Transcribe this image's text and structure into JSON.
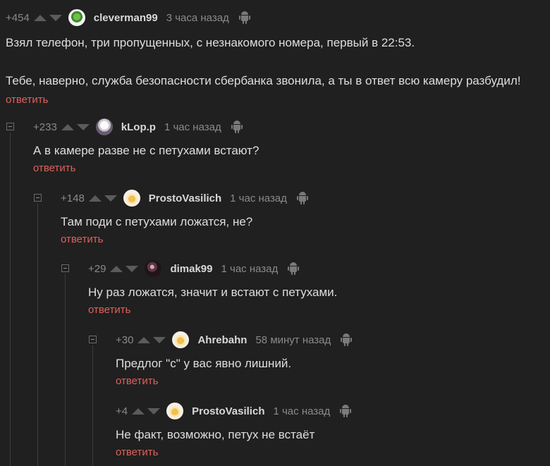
{
  "comments": [
    {
      "rating": "+454",
      "username": "cleverman99",
      "time": "3 часа назад",
      "avatar": "clover-avatar",
      "paragraphs": [
        "Взял телефон, три пропущенных, с незнакомого номера, первый в 22:53.",
        "Тебе, наверно, служба безопасности сбербанка звонила, а ты в ответ всю камеру разбудил!"
      ],
      "reply_label": "ответить"
    },
    {
      "rating": "+233",
      "username": "kLop.p",
      "time": "1 час назад",
      "avatar": "ghost-avatar",
      "text": "А в камере разве не с петухами встают?",
      "reply_label": "ответить"
    },
    {
      "rating": "+148",
      "username": "ProstoVasilich",
      "time": "1 час назад",
      "avatar": "beer-avatar",
      "text": "Там поди с петухами ложатся, не?",
      "reply_label": "ответить"
    },
    {
      "rating": "+29",
      "username": "dimak99",
      "time": "1 час назад",
      "avatar": "dark-avatar",
      "text": "Ну раз ложатся, значит и встают с петухами.",
      "reply_label": "ответить"
    },
    {
      "rating": "+30",
      "username": "Ahrebahn",
      "time": "58 минут назад",
      "avatar": "beer-avatar",
      "text": "Предлог \"с\" у вас явно лишний.",
      "reply_label": "ответить"
    },
    {
      "rating": "+4",
      "username": "ProstoVasilich",
      "time": "1 час назад",
      "avatar": "beer-avatar",
      "text": "Не факт, возможно, петух не встаёт",
      "reply_label": "ответить"
    }
  ],
  "icons": {
    "vote_up": "arrow-up-icon",
    "vote_down": "arrow-down-icon",
    "platform": "android-icon",
    "collapse": "collapse-minus-icon"
  },
  "colors": {
    "background": "#202020",
    "reply": "#e0605a",
    "meta": "#8a8a8a"
  }
}
